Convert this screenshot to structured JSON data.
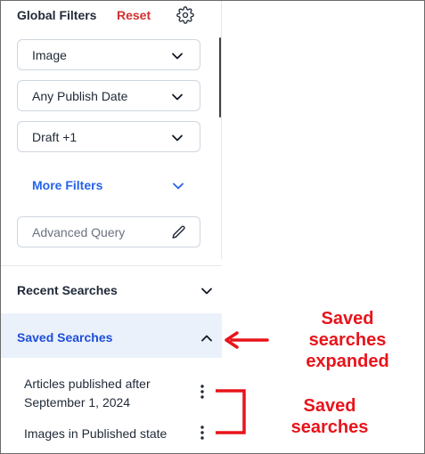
{
  "header": {
    "title": "Global Filters",
    "reset_label": "Reset"
  },
  "filters": {
    "type_value": "Image",
    "date_value": "Any Publish Date",
    "status_value": "Draft +1",
    "more_filters_label": "More Filters",
    "advanced_query_placeholder": "Advanced Query"
  },
  "sections": {
    "recent_label": "Recent Searches",
    "saved_label": "Saved Searches"
  },
  "saved_searches": [
    {
      "title_line1": "Articles published after",
      "title_line2": "September 1, 2024"
    },
    {
      "title_line1": "Images in Published state"
    }
  ],
  "annotations": {
    "expanded_line1": "Saved",
    "expanded_line2": "searches",
    "expanded_line3": "expanded",
    "items_line1": "Saved",
    "items_line2": "searches"
  },
  "colors": {
    "accent_blue": "#2563eb",
    "reset_red": "#d32f2f",
    "annotation_red": "#e8141b",
    "selected_bg": "#eaf1fb"
  },
  "icons": [
    "gear-icon",
    "chevron-down-icon",
    "pencil-icon",
    "chevron-up-icon",
    "kebab-menu-icon",
    "arrow-left-icon",
    "bracket-icon"
  ]
}
